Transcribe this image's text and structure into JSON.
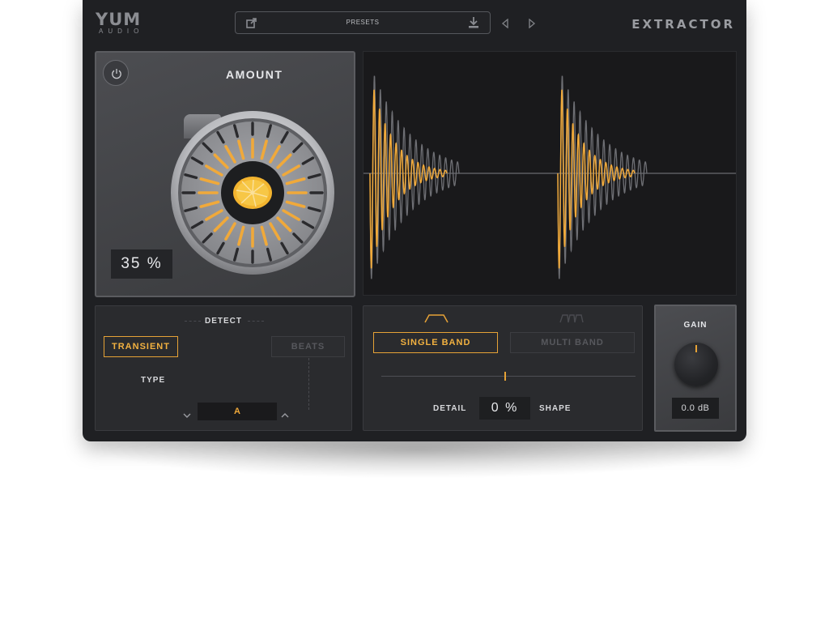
{
  "header": {
    "logo_main": "YUM",
    "logo_sub": "AUDIO",
    "presets_label": "PRESETS",
    "brand": "EXTRACTOR"
  },
  "amount": {
    "title": "AMOUNT",
    "value": "35",
    "unit": "%"
  },
  "detect": {
    "title": "DETECT",
    "transient_label": "TRANSIENT",
    "beats_label": "BEATS",
    "type_label": "TYPE",
    "type_value": "A",
    "selected": "TRANSIENT"
  },
  "band": {
    "single_label": "SINGLE BAND",
    "multi_label": "MULTI BAND",
    "selected": "SINGLE BAND",
    "detail_label": "DETAIL",
    "shape_label": "SHAPE",
    "detail_value": "0",
    "detail_unit": "%"
  },
  "gain": {
    "title": "GAIN",
    "value": "0.0",
    "unit": "dB"
  },
  "colors": {
    "accent": "#f0a93a",
    "background": "#1f2023",
    "panel": "#2a2b2e",
    "waveform_secondary": "#6a6b70"
  },
  "icons": {
    "power": "power-icon",
    "open": "open-external-icon",
    "download": "download-icon",
    "prev": "triangle-left-icon",
    "next": "triangle-right-icon",
    "lemon": "lemon-icon",
    "single_band": "single-band-icon",
    "multi_band": "multi-band-icon",
    "chevron_down": "chevron-down-icon",
    "chevron_up": "chevron-up-icon"
  }
}
